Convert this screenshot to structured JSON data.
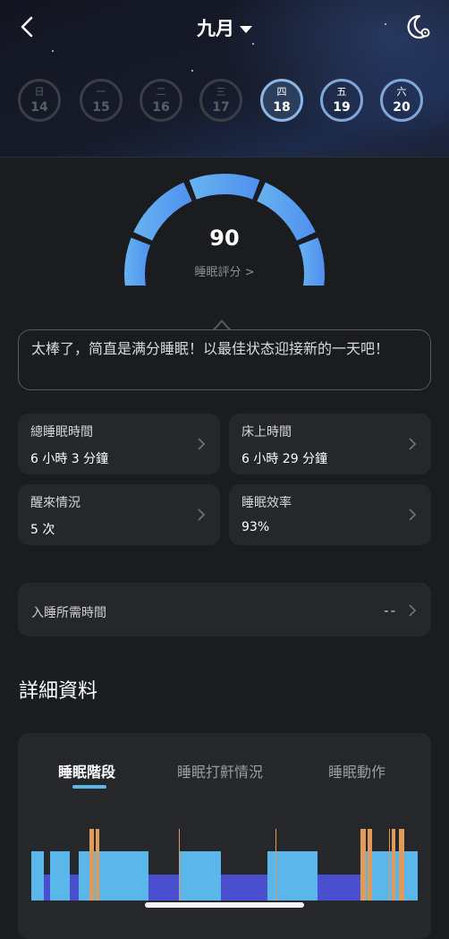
{
  "header": {
    "month": "九月",
    "days": [
      {
        "weekday": "日",
        "date": "14",
        "state": "inactive"
      },
      {
        "weekday": "一",
        "date": "15",
        "state": "inactive"
      },
      {
        "weekday": "二",
        "date": "16",
        "state": "inactive"
      },
      {
        "weekday": "三",
        "date": "17",
        "state": "inactive"
      },
      {
        "weekday": "四",
        "date": "18",
        "state": "selected"
      },
      {
        "weekday": "五",
        "date": "19",
        "state": "active"
      },
      {
        "weekday": "六",
        "date": "20",
        "state": "active"
      }
    ]
  },
  "score": {
    "value": "90",
    "label": "睡眠評分 >",
    "fraction": 0.9
  },
  "tip": "太棒了，简直是满分睡眠！以最佳状态迎接新的一天吧！",
  "stats": {
    "total_sleep": {
      "title": "總睡眠時間",
      "value": "6 小時 3 分鐘"
    },
    "in_bed": {
      "title": "床上時間",
      "value": "6 小時 29 分鐘"
    },
    "awake": {
      "title": "醒來情況",
      "value": "5 次"
    },
    "efficiency": {
      "title": "睡眠效率",
      "value": "93%"
    }
  },
  "latency": {
    "title": "入睡所需時間",
    "value": "--"
  },
  "details": {
    "title": "詳細資料",
    "tabs": [
      "睡眠階段",
      "睡眠打鼾情況",
      "睡眠動作"
    ],
    "active_tab": 0
  },
  "colors": {
    "accent": "#5bb7ea",
    "light_sleep": "#5bb7ea",
    "deep_sleep": "#4a4fcf",
    "awake": "#e09a5a",
    "gauge_start": "#67b3f0",
    "gauge_end": "#4f8ff0"
  },
  "icons": {
    "back": "chevron-left-icon",
    "month_dropdown": "caret-down-icon",
    "theme": "moon-gear-icon",
    "row_chevron": "chevron-right-icon"
  }
}
